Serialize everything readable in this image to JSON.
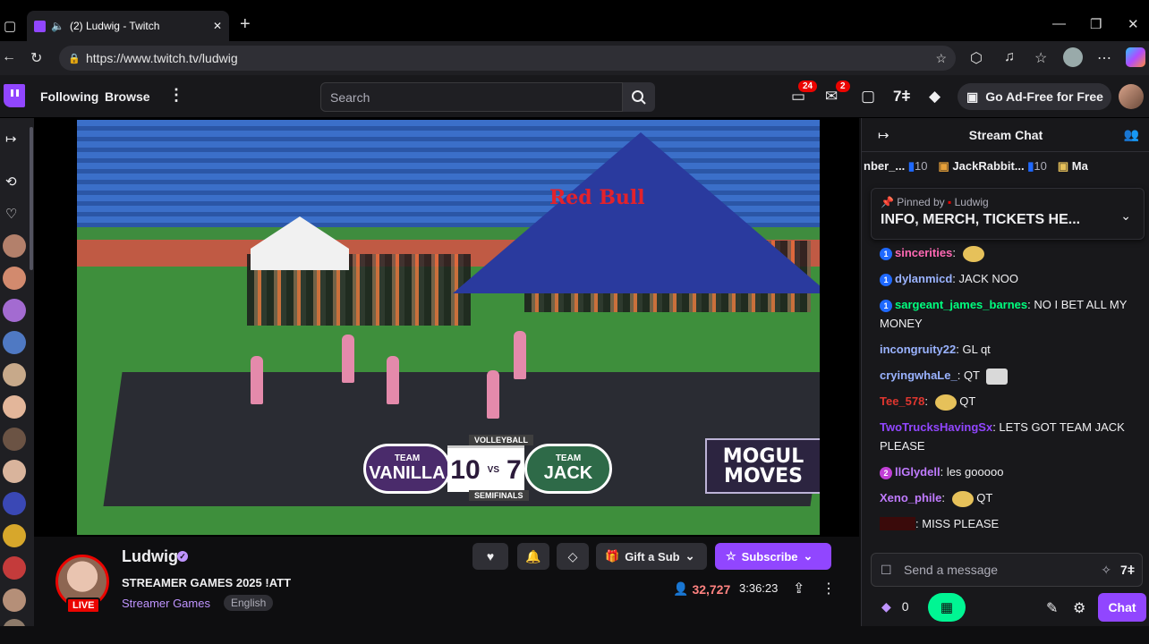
{
  "browser": {
    "tab_title": "(2) Ludwig - Twitch",
    "url": "https://www.twitch.tv/ludwig"
  },
  "topnav": {
    "following": "Following",
    "browse": "Browse",
    "search_placeholder": "Search",
    "inbox_badge": "24",
    "whispers_badge": "2",
    "ad_free": "Go Ad-Free for Free"
  },
  "stream": {
    "scorebug": {
      "label_top": "VOLLEYBALL",
      "label_bottom": "SEMIFINALS",
      "team_left_prefix": "TEAM",
      "team_left": "VANILLA",
      "team_right_prefix": "TEAM",
      "team_right": "JACK",
      "score_left": "10",
      "vs": "VS",
      "score_right": "7"
    },
    "sign": "MOGUL MOVES",
    "tent_text": "Red Bull"
  },
  "channel": {
    "name": "Ludwig",
    "live": "LIVE",
    "title": "STREAMER GAMES 2025 !ATT",
    "category": "Streamer Games",
    "language": "English",
    "gift_sub": "Gift a Sub",
    "subscribe": "Subscribe",
    "viewers": "32,727",
    "uptime": "3:36:23"
  },
  "chat": {
    "header": "Stream Chat",
    "gifters": [
      {
        "name": "nber_...",
        "count": "10"
      },
      {
        "name": "JackRabbit...",
        "count": "10"
      },
      {
        "name": "Ma",
        "count": ""
      }
    ],
    "pinned_by": "Pinned by",
    "pinned_user": "Ludwig",
    "pinned_text": "INFO, MERCH, TICKETS HE...",
    "messages": [
      {
        "user": "sincerities",
        "color": "#ff69b4",
        "text": ""
      },
      {
        "user": "dylanmicd",
        "color": "#9ab3ff",
        "text": "JACK NOO"
      },
      {
        "user": "sargeant_james_barnes",
        "color": "#00ff7f",
        "text": "NO I BET ALL MY MONEY"
      },
      {
        "user": "incongruity22",
        "color": "#9ab3ff",
        "text": "GL qt"
      },
      {
        "user": "cryingwhaLe_",
        "color": "#9ab3ff",
        "text": "QT"
      },
      {
        "user": "Tee_578",
        "color": "#e0362f",
        "text": "QT"
      },
      {
        "user": "TwoTrucksHavingSx",
        "color": "#9146ff",
        "text": "LETS GOT TEAM JACK PLEASE"
      },
      {
        "user": "llGlydell",
        "color": "#c07bff",
        "text": "les gooooo"
      },
      {
        "user": "Xeno_phile",
        "color": "#c07bff",
        "text": "QT"
      },
      {
        "user": "",
        "color": "#8b0000",
        "text": "MISS PLEASE"
      }
    ],
    "input_placeholder": "Send a message",
    "points": "0",
    "chat_button": "Chat"
  },
  "colors": {
    "accent": "#9146ff",
    "live": "#eb0400",
    "predictions": "#00f593"
  }
}
